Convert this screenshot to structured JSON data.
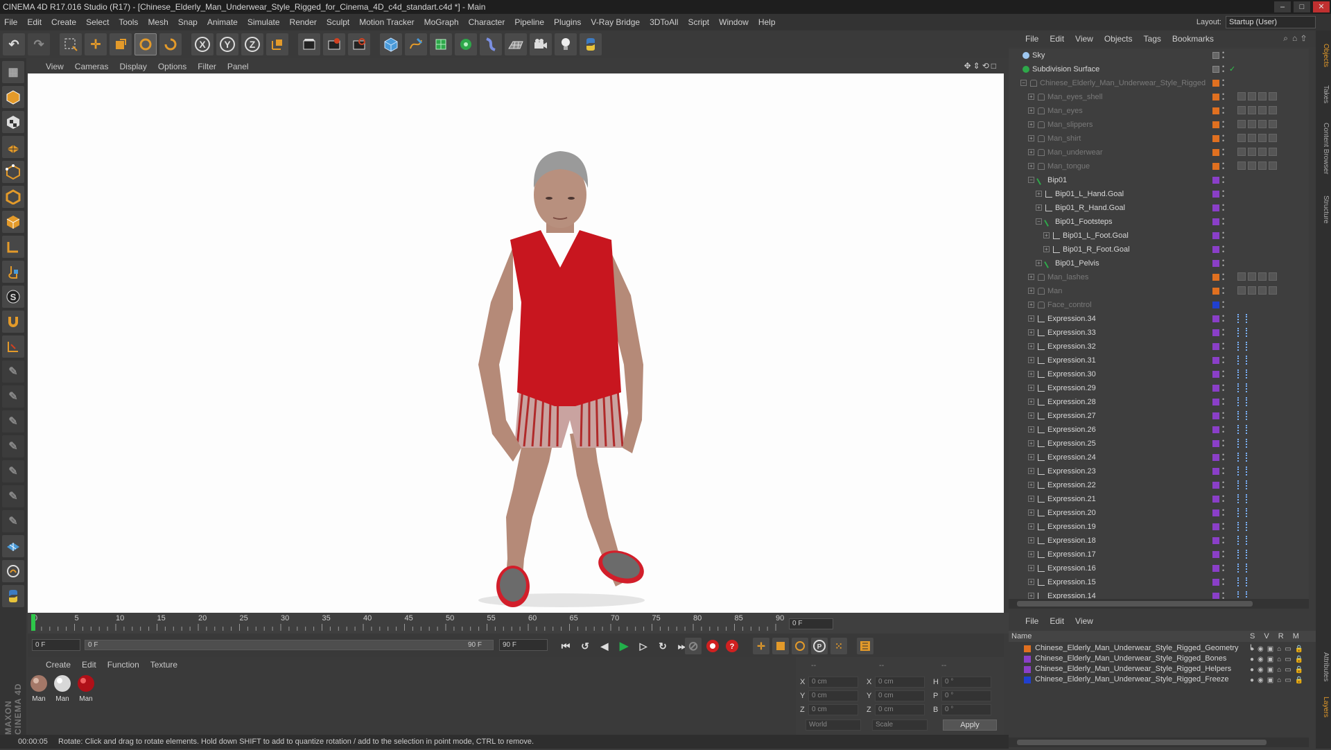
{
  "window": {
    "title": "CINEMA 4D R17.016 Studio (R17) - [Chinese_Elderly_Man_Underwear_Style_Rigged_for_Cinema_4D_c4d_standart.c4d *] - Main"
  },
  "menubar": {
    "items": [
      "File",
      "Edit",
      "Create",
      "Select",
      "Tools",
      "Mesh",
      "Snap",
      "Animate",
      "Simulate",
      "Render",
      "Sculpt",
      "Motion Tracker",
      "MoGraph",
      "Character",
      "Pipeline",
      "Plugins",
      "V-Ray Bridge",
      "3DToAll",
      "Script",
      "Window",
      "Help"
    ],
    "layout_label": "Layout:",
    "layout_value": "Startup (User)"
  },
  "viewport": {
    "menu": [
      "View",
      "Cameras",
      "Display",
      "Options",
      "Filter",
      "Panel"
    ]
  },
  "timeline": {
    "ticks": [
      "0",
      "5",
      "10",
      "15",
      "20",
      "25",
      "30",
      "35",
      "40",
      "45",
      "50",
      "55",
      "60",
      "65",
      "70",
      "75",
      "80",
      "85",
      "90"
    ],
    "current_frame": "0 F",
    "start_field": "0 F",
    "range_start": "0 F",
    "range_end": "90 F",
    "end_field": "90 F",
    "frame_display": "0 F"
  },
  "material_panel": {
    "menu": [
      "Create",
      "Edit",
      "Function",
      "Texture"
    ],
    "materials": [
      {
        "label": "Man"
      },
      {
        "label": "Man"
      },
      {
        "label": "Man"
      }
    ]
  },
  "coordinates": {
    "header_dashes": [
      "--",
      "--",
      "--"
    ],
    "rows": [
      {
        "a_label": "X",
        "a_val": "0 cm",
        "b_label": "X",
        "b_val": "0 cm",
        "c_label": "H",
        "c_val": "0 °"
      },
      {
        "a_label": "Y",
        "a_val": "0 cm",
        "b_label": "Y",
        "b_val": "0 cm",
        "c_label": "P",
        "c_val": "0 °"
      },
      {
        "a_label": "Z",
        "a_val": "0 cm",
        "b_label": "Z",
        "b_val": "0 cm",
        "c_label": "B",
        "c_val": "0 °"
      }
    ],
    "space_select": "World",
    "mode_select": "Scale",
    "apply_label": "Apply"
  },
  "status": {
    "time": "00:00:05",
    "message": "Rotate: Click and drag to rotate elements. Hold down SHIFT to add to quantize rotation / add to the selection in point mode, CTRL to remove."
  },
  "objects_panel": {
    "menu": [
      "File",
      "Edit",
      "View",
      "Objects",
      "Tags",
      "Bookmarks"
    ],
    "items": [
      {
        "label": "Sky",
        "indent": 0,
        "dim": false,
        "swatch": "",
        "tags": "none"
      },
      {
        "label": "Subdivision Surface",
        "indent": 0,
        "dim": false,
        "swatch": "",
        "tags": "none"
      },
      {
        "label": "Chinese_Elderly_Man_Underwear_Style_Rigged",
        "indent": 1,
        "dim": true,
        "swatch": "#e07020",
        "tags": "none"
      },
      {
        "label": "Man_eyes_shell",
        "indent": 2,
        "dim": true,
        "swatch": "#e07020",
        "tags": "mat"
      },
      {
        "label": "Man_eyes",
        "indent": 2,
        "dim": true,
        "swatch": "#e07020",
        "tags": "mat"
      },
      {
        "label": "Man_slippers",
        "indent": 2,
        "dim": true,
        "swatch": "#e07020",
        "tags": "mat"
      },
      {
        "label": "Man_shirt",
        "indent": 2,
        "dim": true,
        "swatch": "#e07020",
        "tags": "mat"
      },
      {
        "label": "Man_underwear",
        "indent": 2,
        "dim": true,
        "swatch": "#e07020",
        "tags": "mat"
      },
      {
        "label": "Man_tongue",
        "indent": 2,
        "dim": true,
        "swatch": "#e07020",
        "tags": "mat"
      },
      {
        "label": "Bip01",
        "indent": 2,
        "dim": false,
        "swatch": "#8a3fc8",
        "tags": "none"
      },
      {
        "label": "Bip01_L_Hand.Goal",
        "indent": 3,
        "dim": false,
        "swatch": "#8a3fc8",
        "tags": "none"
      },
      {
        "label": "Bip01_R_Hand.Goal",
        "indent": 3,
        "dim": false,
        "swatch": "#8a3fc8",
        "tags": "none"
      },
      {
        "label": "Bip01_Footsteps",
        "indent": 3,
        "dim": false,
        "swatch": "#8a3fc8",
        "tags": "none"
      },
      {
        "label": "Bip01_L_Foot.Goal",
        "indent": 4,
        "dim": false,
        "swatch": "#8a3fc8",
        "tags": "none"
      },
      {
        "label": "Bip01_R_Foot.Goal",
        "indent": 4,
        "dim": false,
        "swatch": "#8a3fc8",
        "tags": "none"
      },
      {
        "label": "Bip01_Pelvis",
        "indent": 3,
        "dim": false,
        "swatch": "#8a3fc8",
        "tags": "none"
      },
      {
        "label": "Man_lashes",
        "indent": 2,
        "dim": true,
        "swatch": "#e07020",
        "tags": "mat"
      },
      {
        "label": "Man",
        "indent": 2,
        "dim": true,
        "swatch": "#e07020",
        "tags": "mat"
      },
      {
        "label": "Face_control",
        "indent": 2,
        "dim": true,
        "swatch": "#2040d0",
        "tags": "none"
      },
      {
        "label": "Expression.34",
        "indent": 2,
        "dim": false,
        "swatch": "#8a3fc8",
        "tags": "expr"
      },
      {
        "label": "Expression.33",
        "indent": 2,
        "dim": false,
        "swatch": "#8a3fc8",
        "tags": "expr"
      },
      {
        "label": "Expression.32",
        "indent": 2,
        "dim": false,
        "swatch": "#8a3fc8",
        "tags": "expr"
      },
      {
        "label": "Expression.31",
        "indent": 2,
        "dim": false,
        "swatch": "#8a3fc8",
        "tags": "expr"
      },
      {
        "label": "Expression.30",
        "indent": 2,
        "dim": false,
        "swatch": "#8a3fc8",
        "tags": "expr"
      },
      {
        "label": "Expression.29",
        "indent": 2,
        "dim": false,
        "swatch": "#8a3fc8",
        "tags": "expr"
      },
      {
        "label": "Expression.28",
        "indent": 2,
        "dim": false,
        "swatch": "#8a3fc8",
        "tags": "expr"
      },
      {
        "label": "Expression.27",
        "indent": 2,
        "dim": false,
        "swatch": "#8a3fc8",
        "tags": "expr"
      },
      {
        "label": "Expression.26",
        "indent": 2,
        "dim": false,
        "swatch": "#8a3fc8",
        "tags": "expr"
      },
      {
        "label": "Expression.25",
        "indent": 2,
        "dim": false,
        "swatch": "#8a3fc8",
        "tags": "expr"
      },
      {
        "label": "Expression.24",
        "indent": 2,
        "dim": false,
        "swatch": "#8a3fc8",
        "tags": "expr"
      },
      {
        "label": "Expression.23",
        "indent": 2,
        "dim": false,
        "swatch": "#8a3fc8",
        "tags": "expr"
      },
      {
        "label": "Expression.22",
        "indent": 2,
        "dim": false,
        "swatch": "#8a3fc8",
        "tags": "expr"
      },
      {
        "label": "Expression.21",
        "indent": 2,
        "dim": false,
        "swatch": "#8a3fc8",
        "tags": "expr"
      },
      {
        "label": "Expression.20",
        "indent": 2,
        "dim": false,
        "swatch": "#8a3fc8",
        "tags": "expr"
      },
      {
        "label": "Expression.19",
        "indent": 2,
        "dim": false,
        "swatch": "#8a3fc8",
        "tags": "expr"
      },
      {
        "label": "Expression.18",
        "indent": 2,
        "dim": false,
        "swatch": "#8a3fc8",
        "tags": "expr"
      },
      {
        "label": "Expression.17",
        "indent": 2,
        "dim": false,
        "swatch": "#8a3fc8",
        "tags": "expr"
      },
      {
        "label": "Expression.16",
        "indent": 2,
        "dim": false,
        "swatch": "#8a3fc8",
        "tags": "expr"
      },
      {
        "label": "Expression.15",
        "indent": 2,
        "dim": false,
        "swatch": "#8a3fc8",
        "tags": "expr"
      },
      {
        "label": "Expression.14",
        "indent": 2,
        "dim": false,
        "swatch": "#8a3fc8",
        "tags": "expr"
      }
    ]
  },
  "layers_panel": {
    "menu": [
      "File",
      "Edit",
      "View"
    ],
    "header": {
      "name": "Name",
      "cols": "S V R M L"
    },
    "layers": [
      {
        "label": "Chinese_Elderly_Man_Underwear_Style_Rigged_Geometry",
        "color": "#e07020"
      },
      {
        "label": "Chinese_Elderly_Man_Underwear_Style_Rigged_Bones",
        "color": "#8a3fc8"
      },
      {
        "label": "Chinese_Elderly_Man_Underwear_Style_Rigged_Helpers",
        "color": "#8a3fc8"
      },
      {
        "label": "Chinese_Elderly_Man_Underwear_Style_Rigged_Freeze",
        "color": "#2040d0"
      }
    ]
  },
  "side_tabs": [
    "Objects",
    "Takes",
    "Content Browser",
    "Structure",
    "Attributes",
    "Layers"
  ],
  "logo": "MAXON CINEMA 4D",
  "colors": {
    "accent": "#e39a2a",
    "green_play": "#22b04a",
    "record_red": "#d02020"
  }
}
